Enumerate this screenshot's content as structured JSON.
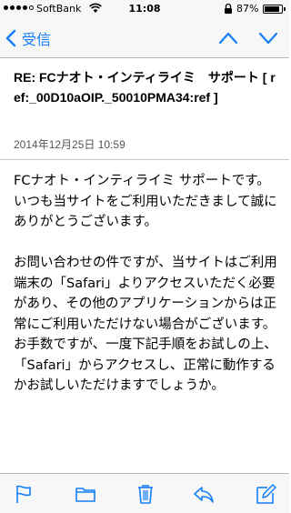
{
  "status_bar": {
    "carrier": "SoftBank",
    "time": "11:08",
    "battery_percent_label": "87%",
    "battery_level": 0.87
  },
  "nav": {
    "back_label": "受信",
    "accent_color": "#157efb"
  },
  "email": {
    "subject": "RE: FCナオト・インティライミ　サポート [ ref:_00D10aOIP._50010PMA34:ref ]",
    "date": "2014年12月25日 10:59",
    "body_paragraphs": [
      "FCナオト・インティライミ サポートです。",
      "いつも当サイトをご利用いただきまして誠にありがとうございます。",
      "",
      "お問い合わせの件ですが、当サイトはご利用端末の「Safari」よりアクセスいただく必要があり、その他のアプリケーションからは正常にご利用いただけない場合がございます。",
      "お手数ですが、一度下記手順をお試しの上、「Safari」からアクセスし、正常に動作するかお試しいただけますでしょうか。"
    ]
  },
  "toolbar": {
    "icons": [
      "flag-icon",
      "folder-icon",
      "trash-icon",
      "reply-icon",
      "compose-icon"
    ]
  }
}
